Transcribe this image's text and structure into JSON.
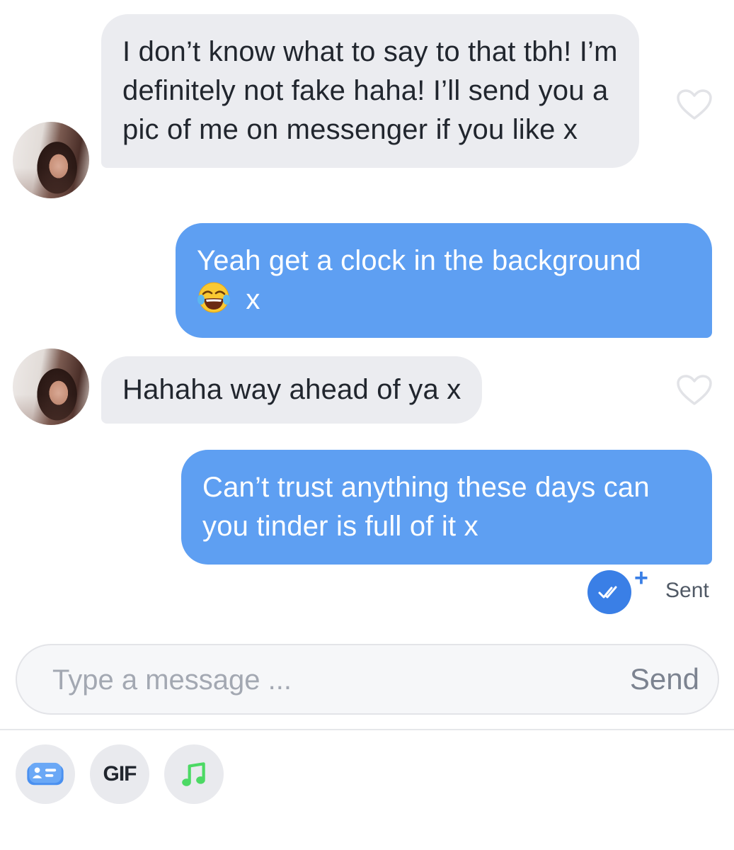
{
  "messages": [
    {
      "sender": "them",
      "text": "I don’t know what to say to that tbh! I’m definitely not fake haha! I’ll send you a pic of me on messenger if you like x"
    },
    {
      "sender": "me",
      "text": "Yeah get a clock in the background",
      "suffix": "x",
      "emoji": "face-with-tears-of-joy"
    },
    {
      "sender": "them",
      "text": "Hahaha way ahead of ya x"
    },
    {
      "sender": "me",
      "text": "Can’t trust anything these days can you tinder is full of it x"
    }
  ],
  "status": {
    "label": "Sent",
    "plus": "+"
  },
  "composer": {
    "placeholder": "Type a message ...",
    "send_label": "Send"
  },
  "toolbar": {
    "gif_label": "GIF"
  },
  "colors": {
    "outgoing_bubble": "#5e9ff2",
    "incoming_bubble": "#ebecf0",
    "sent_accent": "#3a7fe6",
    "music_icon": "#4cd964"
  }
}
